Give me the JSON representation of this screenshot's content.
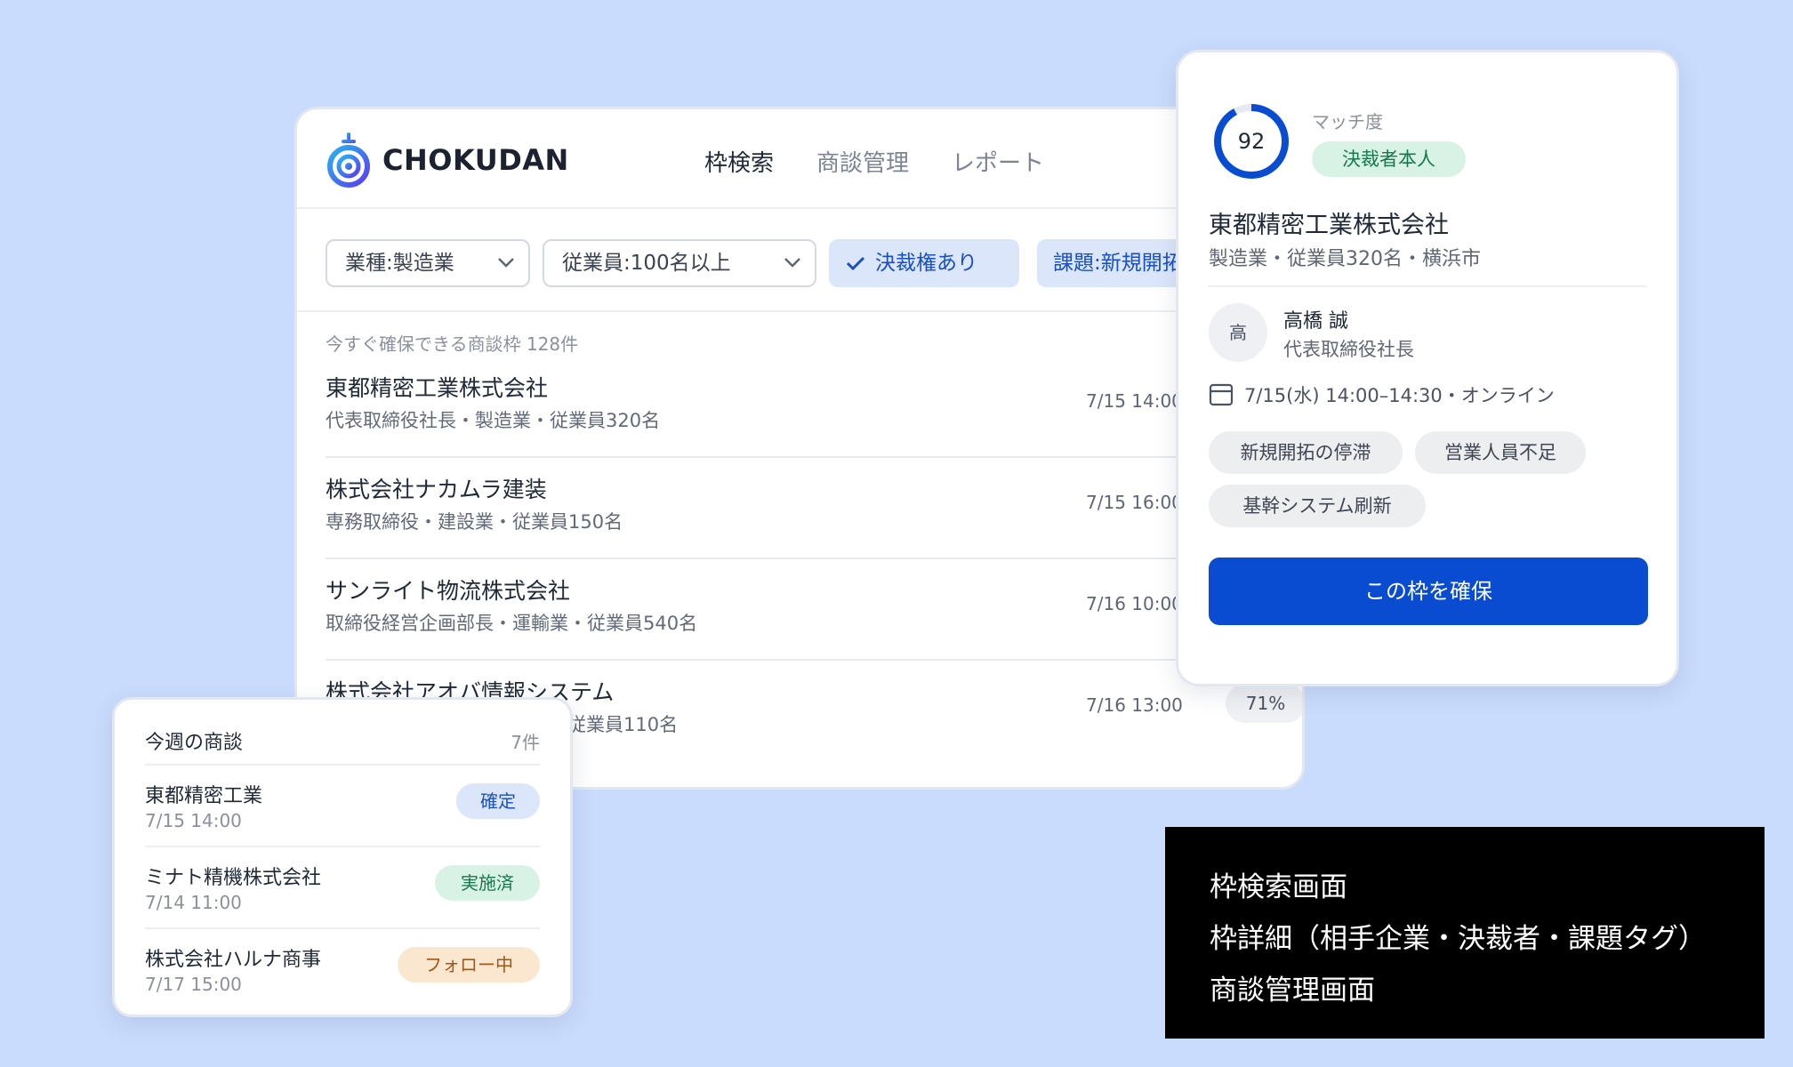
{
  "brand": {
    "name": "CHOKUDAN"
  },
  "nav": {
    "items": [
      "枠検索",
      "商談管理",
      "レポート"
    ]
  },
  "filters": {
    "industry": "業種:製造業",
    "employees": "従業員:100名以上",
    "authority": "決裁権あり",
    "issue": "課題:新規開拓"
  },
  "results": {
    "count_text": "今すぐ確保できる商談枠 128件",
    "rows": [
      {
        "company": "東都精密工業株式会社",
        "detail": "代表取締役社長・製造業・従業員320名",
        "time": "7/15 14:00",
        "score": ""
      },
      {
        "company": "株式会社ナカムラ建装",
        "detail": "専務取締役・建設業・従業員150名",
        "time": "7/15 16:00",
        "score": ""
      },
      {
        "company": "サンライト物流株式会社",
        "detail": "取締役経営企画部長・運輸業・従業員540名",
        "time": "7/16 10:00",
        "score": ""
      },
      {
        "company": "株式会社アオバ情報システム",
        "detail": "従業員110名",
        "time": "7/16 13:00",
        "score": "71%"
      }
    ]
  },
  "detail": {
    "match_label": "マッチ度",
    "match_score": "92",
    "match_value": 0.92,
    "decision_badge": "決裁者本人",
    "company": "東都精密工業株式会社",
    "meta": "製造業・従業員320名・横浜市",
    "avatar_initial": "高",
    "person_name": "高橋 誠",
    "person_title": "代表取締役社長",
    "schedule": "7/15(水) 14:00–14:30・オンライン",
    "tags": [
      "新規開拓の停滞",
      "営業人員不足",
      "基幹システム刷新"
    ],
    "cta": "この枠を確保"
  },
  "week": {
    "title": "今週の商談",
    "count": "7件",
    "items": [
      {
        "name": "東都精密工業",
        "time": "7/15 14:00",
        "status": "確定",
        "status_color": "#1a4fc4",
        "status_bg": "#dbe6fb"
      },
      {
        "name": "ミナト精機株式会社",
        "time": "7/14 11:00",
        "status": "実施済",
        "status_color": "#17784d",
        "status_bg": "#d9f2e6"
      },
      {
        "name": "株式会社ハルナ商事",
        "time": "7/17 15:00",
        "status": "フォロー中",
        "status_color": "#a0581a",
        "status_bg": "#fbe7cf"
      }
    ]
  },
  "caption": {
    "lines": [
      "枠検索画面",
      "枠詳細（相手企業・決裁者・課題タグ）",
      "商談管理画面"
    ]
  },
  "colors": {
    "accent": "#0a4cd1",
    "background": "#cadcfd"
  }
}
